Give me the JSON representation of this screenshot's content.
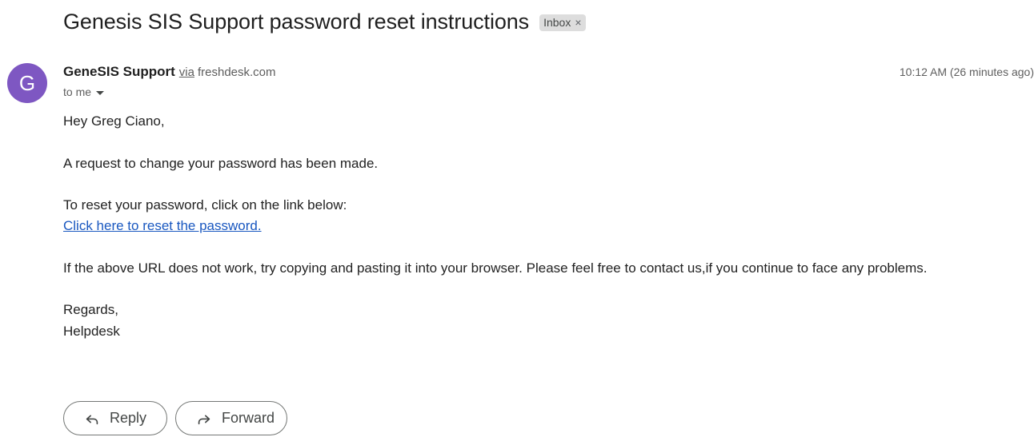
{
  "email": {
    "subject": "Genesis SIS Support password reset instructions",
    "label": "Inbox",
    "label_close": "×",
    "avatar_letter": "G",
    "sender_name": "GeneSIS Support",
    "sender_via": "via",
    "sender_domain": "freshdesk.com",
    "timestamp": "10:12 AM (26 minutes ago)",
    "recipient": "to me",
    "body": {
      "greeting": "Hey Greg Ciano,",
      "line1": "A request to change your password has been made.",
      "line2": "To reset your password, click on the link below:",
      "link_text": "Click here to reset the password.",
      "line3": "If the above URL does not work, try copying and pasting it into your browser. Please feel free to contact us,if you continue to face any problems.",
      "regards": "Regards,",
      "signature": "Helpdesk"
    }
  },
  "actions": {
    "reply_label": "Reply",
    "forward_label": "Forward",
    "reply_icon": "reply-arrow-icon",
    "forward_icon": "forward-arrow-icon"
  },
  "colors": {
    "avatar_bg": "#7e57c2",
    "link": "#1a58c0",
    "label_chip_bg": "#dddddd"
  }
}
